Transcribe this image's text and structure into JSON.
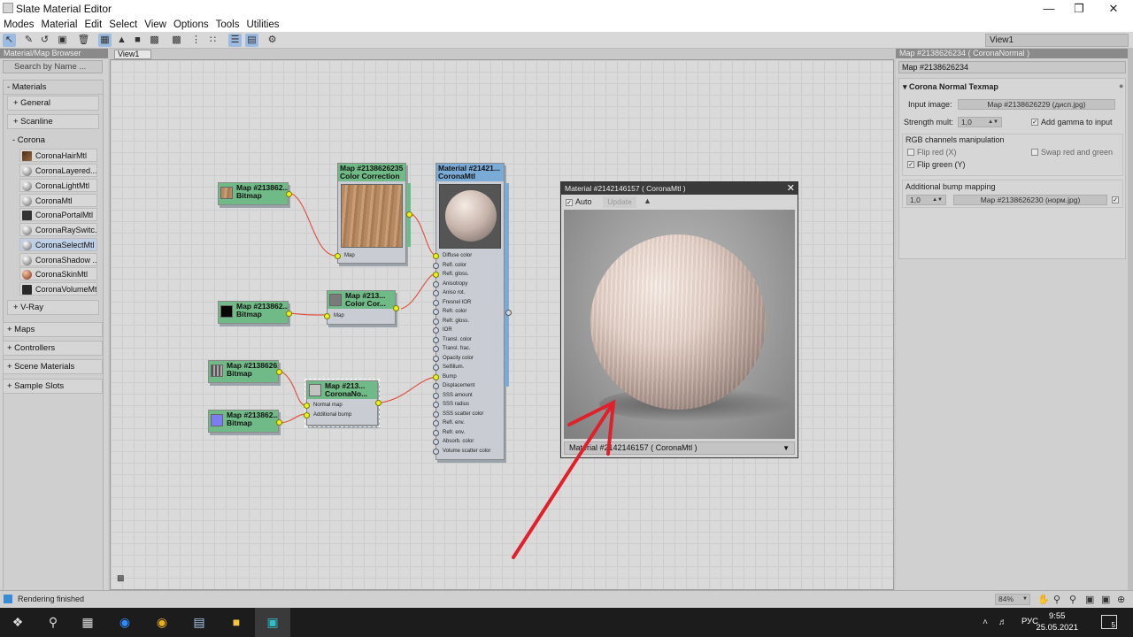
{
  "window": {
    "title": "Slate Material Editor"
  },
  "menu": [
    "Modes",
    "Material",
    "Edit",
    "Select",
    "View",
    "Options",
    "Tools",
    "Utilities"
  ],
  "toolbar": {
    "view_selector": "View1"
  },
  "browser": {
    "header": "Material/Map Browser",
    "search_placeholder": "Search by Name ...",
    "materials_label": "- Materials",
    "general_label": "+ General",
    "scanline_label": "+ Scanline",
    "corona_label": "- Corona",
    "corona_items": [
      "CoronaHairMtl",
      "CoronaLayered...",
      "CoronaLightMtl",
      "CoronaMtl",
      "CoronaPortalMtl",
      "CoronaRaySwitc...",
      "CoronaSelectMtl",
      "CoronaShadow ...",
      "CoronaSkinMtl",
      "CoronaVolumeMtl"
    ],
    "vray_label": "+ V-Ray",
    "maps_label": "+ Maps",
    "controllers_label": "+ Controllers",
    "scene_materials_label": "+ Scene Materials",
    "sample_slots_label": "+ Sample Slots"
  },
  "view": {
    "tab": "View1"
  },
  "nodes": {
    "bitmap1": {
      "title": "Map #213862...",
      "type": "Bitmap"
    },
    "colorcorr1": {
      "title": "Map #2138626235",
      "type": "Color Correction",
      "port": "Map"
    },
    "bitmap2": {
      "title": "Map #213862...",
      "type": "Bitmap"
    },
    "colorcorr2": {
      "title": "Map #213...",
      "type": "Color Cor...",
      "port": "Map"
    },
    "bitmap3": {
      "title": "Map #2138626...",
      "type": "Bitmap"
    },
    "bitmap4": {
      "title": "Map #213862...",
      "type": "Bitmap"
    },
    "normal": {
      "title": "Map #213...",
      "type": "CoronaNo...",
      "ports": [
        "Normal map",
        "Additional bump"
      ]
    },
    "material": {
      "title": "Material #21421...",
      "type": "CoronaMtl",
      "ports": [
        "Diffuse color",
        "Refl. color",
        "Refl. gloss.",
        "Anisotropy",
        "Aniso rot.",
        "Fresnel IOR",
        "Refr. color",
        "Refr. gloss.",
        "IOR",
        "Transl. color",
        "Transl. frac.",
        "Opacity color",
        "Selfillum.",
        "Bump",
        "Displacement",
        "SSS amount",
        "SSS radius",
        "SSS scatter color",
        "Refl. env.",
        "Refr. env.",
        "Absorb. color",
        "Volume scatter color"
      ]
    }
  },
  "preview": {
    "title": "Material #2142146157  ( CoronaMtl )",
    "auto_label": "Auto",
    "update_label": "Update",
    "footer": "Material #2142146157  ( CoronaMtl )"
  },
  "params": {
    "header": "Map #2138626234  ( CoronaNormal )",
    "name": "Map #2138626234",
    "rollout": "Corona Normal Texmap",
    "input_image_label": "Input image:",
    "input_image_value": "Map #2138626229 (дисп.jpg)",
    "strength_label": "Strength mult:",
    "strength_value": "1,0",
    "add_gamma_label": "Add gamma to input",
    "rgb_label": "RGB channels manipulation",
    "flip_red_label": "Flip red (X)",
    "swap_label": "Swap red and green",
    "flip_green_label": "Flip green (Y)",
    "bump_label": "Additional bump mapping",
    "bump_value": "1,0",
    "bump_map": "Map #2138626230 (норм.jpg)"
  },
  "status": {
    "text": "Rendering finished",
    "zoom": "84%"
  },
  "taskbar": {
    "lang": "РУС",
    "time": "9:55",
    "date": "25.05.2021",
    "notif": "5"
  }
}
